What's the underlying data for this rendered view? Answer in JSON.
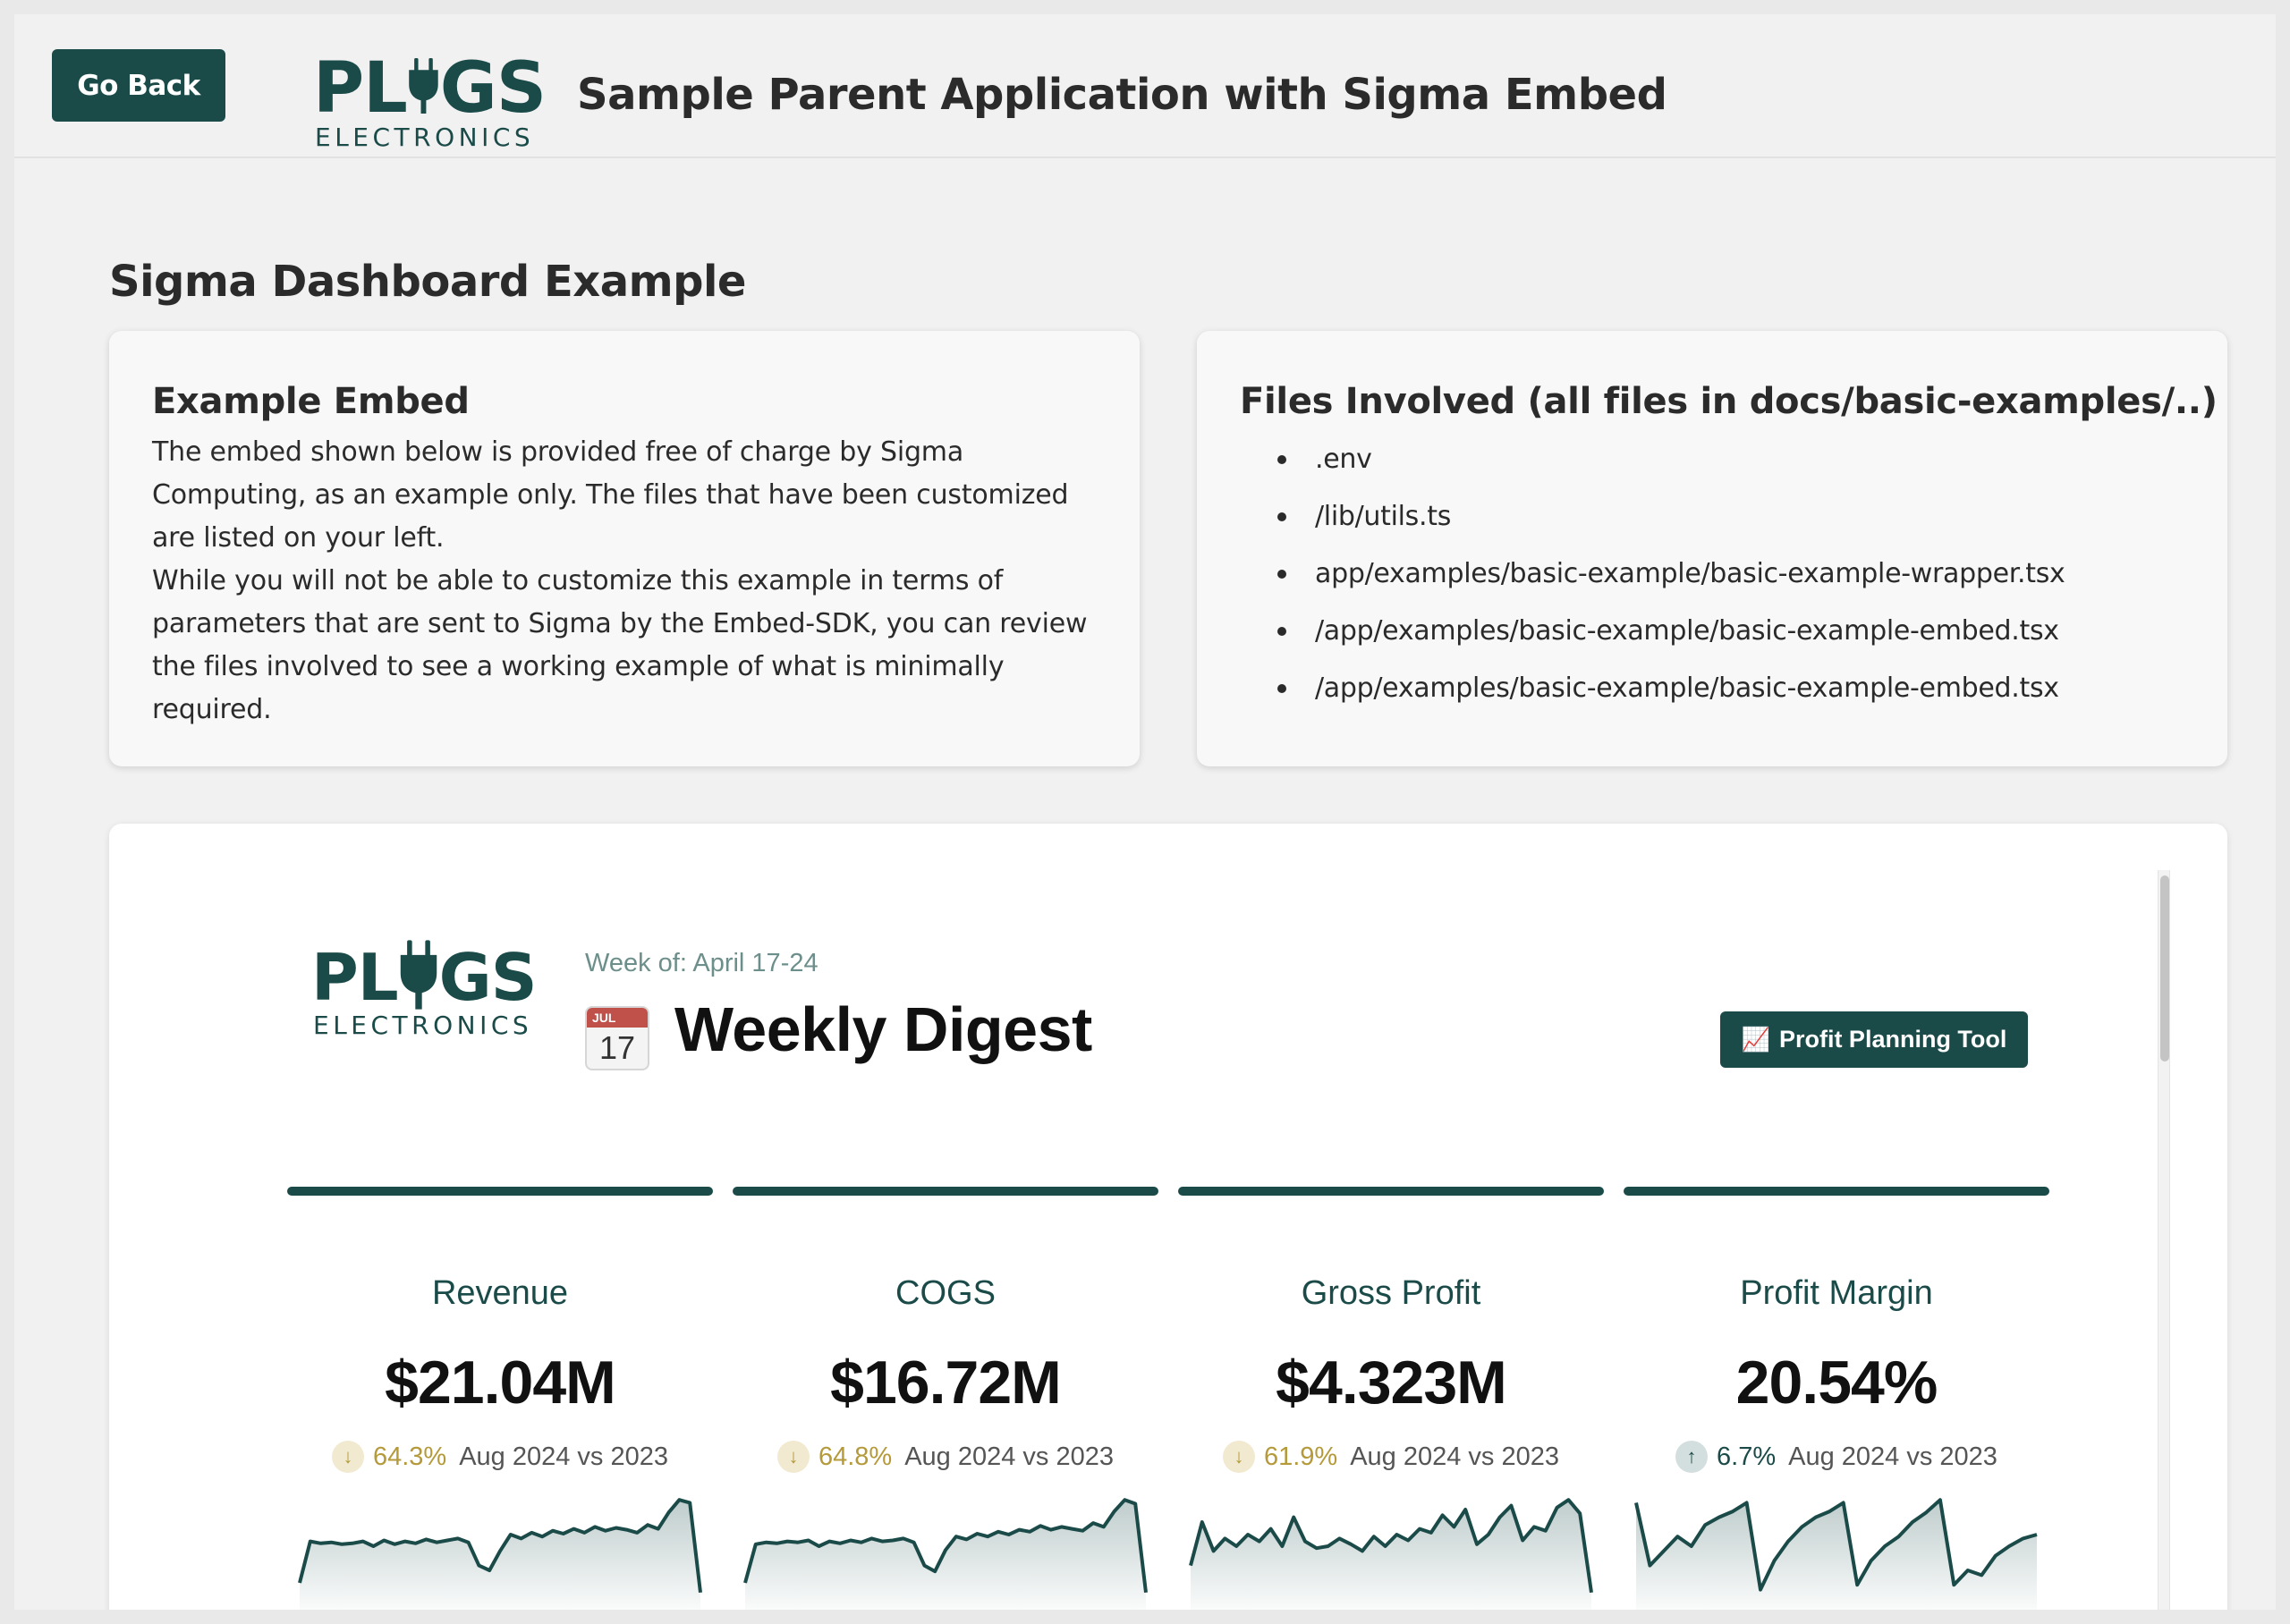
{
  "header": {
    "back_label": "Go Back",
    "logo_prefix": "PL",
    "logo_suffix": "GS",
    "logo_sub": "ELECTRONICS",
    "title": "Sample Parent Application with Sigma Embed"
  },
  "page": {
    "section_title": "Sigma Dashboard Example"
  },
  "example_card": {
    "title": "Example Embed",
    "paragraph1": "The embed shown below is provided free of charge by Sigma Computing, as an example only. The files that have been customized are listed on your left.",
    "paragraph2": "While you will not be able to customize this example in terms of parameters that are sent to Sigma by the Embed-SDK, you can review the files involved to see a working example of what is minimally required."
  },
  "files_card": {
    "title": "Files Involved (all files in docs/basic-examples/..)",
    "files": [
      ".env",
      "/lib/utils.ts",
      "app/examples/basic-example/basic-example-wrapper.tsx",
      "/app/examples/basic-example/basic-example-embed.tsx",
      "/app/examples/basic-example/basic-example-embed.tsx"
    ]
  },
  "embed": {
    "logo_prefix": "PL",
    "logo_suffix": "GS",
    "logo_sub": "ELECTRONICS",
    "week_of": "Week of: April 17-24",
    "calendar_month": "JUL",
    "calendar_day": "17",
    "title": "Weekly Digest",
    "profit_button_icon": "📈",
    "profit_button_label": "Profit Planning Tool",
    "kpis": [
      {
        "label": "Revenue",
        "value": "$21.04M",
        "direction": "down",
        "arrow": "↓",
        "pct": "64.3%",
        "compare": "Aug 2024 vs 2023"
      },
      {
        "label": "COGS",
        "value": "$16.72M",
        "direction": "down",
        "arrow": "↓",
        "pct": "64.8%",
        "compare": "Aug 2024 vs 2023"
      },
      {
        "label": "Gross Profit",
        "value": "$4.323M",
        "direction": "down",
        "arrow": "↓",
        "pct": "61.9%",
        "compare": "Aug 2024 vs 2023"
      },
      {
        "label": "Profit Margin",
        "value": "20.54%",
        "direction": "up",
        "arrow": "↑",
        "pct": "6.7%",
        "compare": "Aug 2024 vs 2023"
      }
    ],
    "sparklines": [
      [
        0.12,
        0.55,
        0.53,
        0.54,
        0.52,
        0.53,
        0.55,
        0.5,
        0.56,
        0.52,
        0.55,
        0.53,
        0.57,
        0.54,
        0.56,
        0.58,
        0.54,
        0.3,
        0.25,
        0.45,
        0.62,
        0.58,
        0.64,
        0.6,
        0.66,
        0.63,
        0.68,
        0.64,
        0.7,
        0.66,
        0.69,
        0.67,
        0.64,
        0.72,
        0.68,
        0.85,
        0.98,
        0.95,
        0.02
      ],
      [
        0.12,
        0.52,
        0.54,
        0.53,
        0.55,
        0.54,
        0.56,
        0.5,
        0.55,
        0.53,
        0.56,
        0.54,
        0.58,
        0.55,
        0.56,
        0.58,
        0.54,
        0.3,
        0.24,
        0.46,
        0.6,
        0.57,
        0.63,
        0.6,
        0.65,
        0.62,
        0.67,
        0.65,
        0.71,
        0.67,
        0.7,
        0.68,
        0.66,
        0.74,
        0.7,
        0.86,
        0.98,
        0.94,
        0.02
      ],
      [
        0.3,
        0.75,
        0.45,
        0.58,
        0.5,
        0.62,
        0.55,
        0.68,
        0.5,
        0.8,
        0.55,
        0.48,
        0.5,
        0.58,
        0.52,
        0.45,
        0.6,
        0.5,
        0.62,
        0.56,
        0.68,
        0.64,
        0.82,
        0.7,
        0.88,
        0.52,
        0.62,
        0.8,
        0.92,
        0.56,
        0.7,
        0.66,
        0.9,
        0.98,
        0.84,
        0.02
      ],
      [
        0.95,
        0.3,
        0.45,
        0.6,
        0.5,
        0.72,
        0.8,
        0.86,
        0.95,
        0.05,
        0.35,
        0.55,
        0.7,
        0.8,
        0.86,
        0.95,
        0.1,
        0.35,
        0.5,
        0.6,
        0.75,
        0.85,
        0.98,
        0.1,
        0.25,
        0.2,
        0.4,
        0.5,
        0.58,
        0.62
      ]
    ]
  }
}
